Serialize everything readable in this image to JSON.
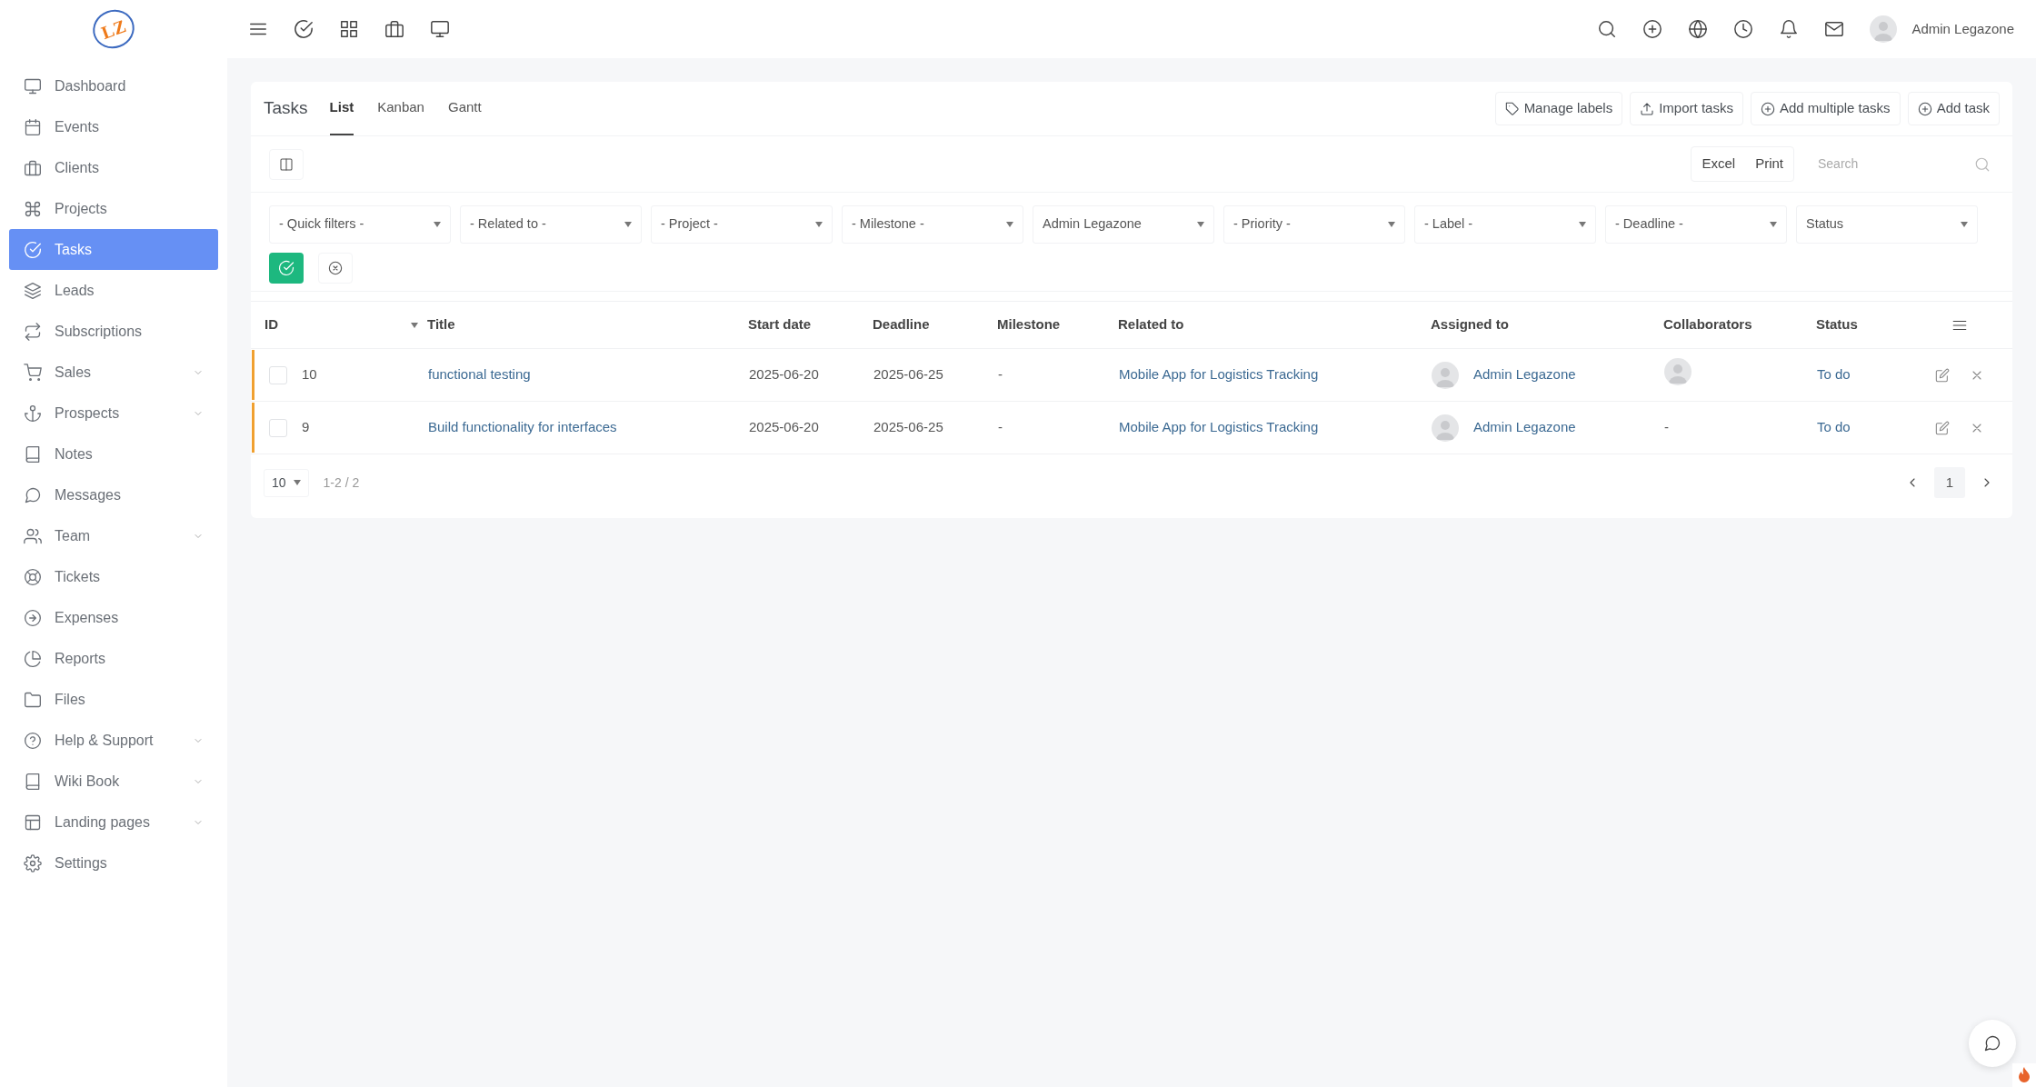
{
  "header": {
    "logo_text": "LZ",
    "user_name": "Admin Legazone"
  },
  "sidebar": {
    "items": [
      {
        "label": "Dashboard",
        "selected": false,
        "has_submenu": false
      },
      {
        "label": "Events",
        "selected": false,
        "has_submenu": false
      },
      {
        "label": "Clients",
        "selected": false,
        "has_submenu": false
      },
      {
        "label": "Projects",
        "selected": false,
        "has_submenu": false
      },
      {
        "label": "Tasks",
        "selected": true,
        "has_submenu": false
      },
      {
        "label": "Leads",
        "selected": false,
        "has_submenu": false
      },
      {
        "label": "Subscriptions",
        "selected": false,
        "has_submenu": false
      },
      {
        "label": "Sales",
        "selected": false,
        "has_submenu": true
      },
      {
        "label": "Prospects",
        "selected": false,
        "has_submenu": true
      },
      {
        "label": "Notes",
        "selected": false,
        "has_submenu": false
      },
      {
        "label": "Messages",
        "selected": false,
        "has_submenu": false
      },
      {
        "label": "Team",
        "selected": false,
        "has_submenu": true
      },
      {
        "label": "Tickets",
        "selected": false,
        "has_submenu": false
      },
      {
        "label": "Expenses",
        "selected": false,
        "has_submenu": false
      },
      {
        "label": "Reports",
        "selected": false,
        "has_submenu": false
      },
      {
        "label": "Files",
        "selected": false,
        "has_submenu": false
      },
      {
        "label": "Help & Support",
        "selected": false,
        "has_submenu": true
      },
      {
        "label": "Wiki Book",
        "selected": false,
        "has_submenu": true
      },
      {
        "label": "Landing pages",
        "selected": false,
        "has_submenu": true
      },
      {
        "label": "Settings",
        "selected": false,
        "has_submenu": false
      }
    ]
  },
  "page": {
    "title": "Tasks",
    "tabs": [
      {
        "label": "List",
        "selected": true
      },
      {
        "label": "Kanban",
        "selected": false
      },
      {
        "label": "Gantt",
        "selected": false
      }
    ],
    "actions": [
      "Manage labels",
      "Import tasks",
      "Add multiple tasks",
      "Add task"
    ],
    "export_buttons": [
      "Excel",
      "Print"
    ],
    "search": {
      "placeholder": "Search"
    },
    "filters": [
      "- Quick filters -",
      "- Related to -",
      "- Project -",
      "- Milestone -",
      "Admin Legazone",
      "- Priority -",
      "- Label -",
      "- Deadline -",
      "Status"
    ],
    "table": {
      "columns": [
        "ID",
        "Title",
        "Start date",
        "Deadline",
        "Milestone",
        "Related to",
        "Assigned to",
        "Collaborators",
        "Status"
      ],
      "rows": [
        {
          "checked": false,
          "color": "#f0a030",
          "id": "10",
          "title": "functional testing",
          "start_date": "2025-06-20",
          "deadline": "2025-06-25",
          "milestone": "-",
          "related_to": "Mobile App for Logistics Tracking",
          "assigned_to": "Admin Legazone",
          "collaborators": {
            "kind": "avatar"
          },
          "status": "To do"
        },
        {
          "checked": false,
          "color": "#f0a030",
          "id": "9",
          "title": "Build functionality for interfaces",
          "start_date": "2025-06-20",
          "deadline": "2025-06-25",
          "milestone": "-",
          "related_to": "Mobile App for Logistics Tracking",
          "assigned_to": "Admin Legazone",
          "collaborators": {
            "kind": "text",
            "text": "-"
          },
          "status": "To do"
        }
      ]
    },
    "pagination": {
      "page_size": "10",
      "range": "1-2 / 2",
      "pages": [
        {
          "label": "1",
          "selected": true
        }
      ]
    }
  }
}
